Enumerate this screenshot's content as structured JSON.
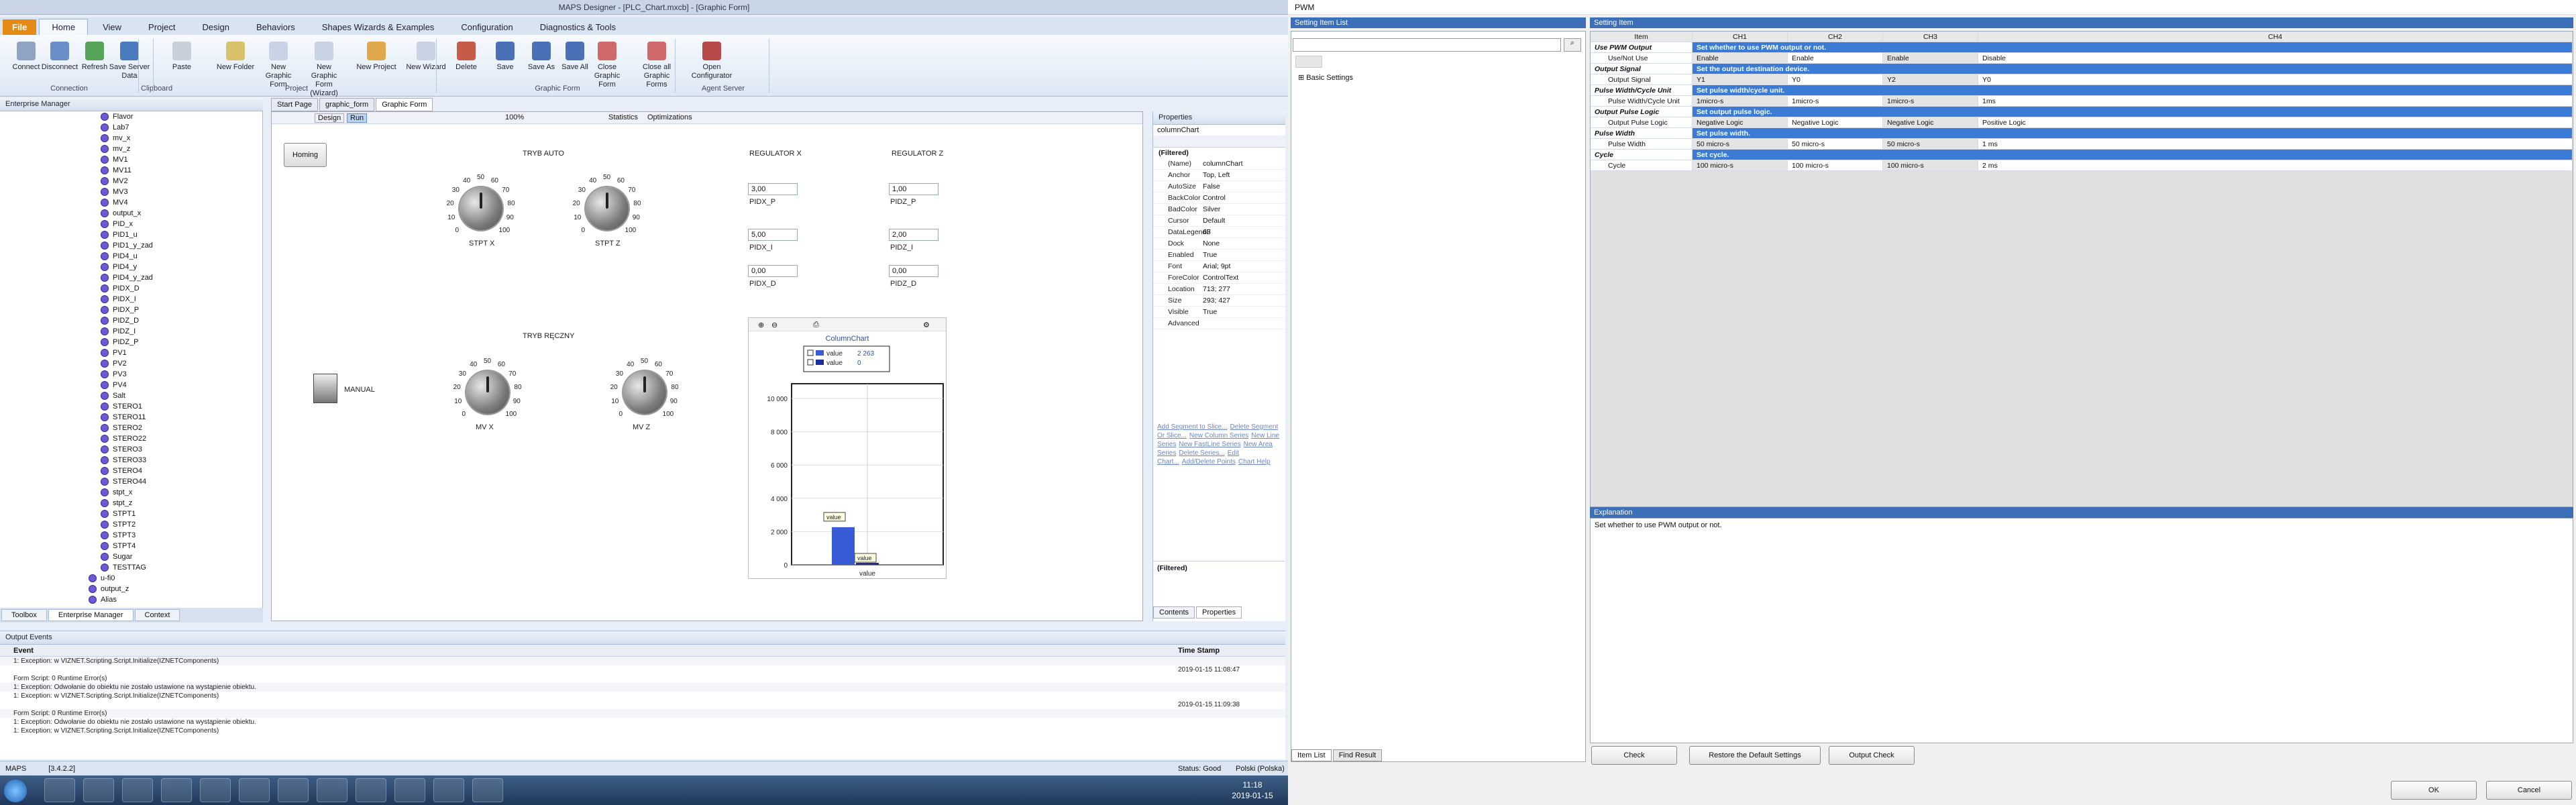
{
  "left_window": {
    "title": "MAPS Designer - [PLC_Chart.mxcb] - [Graphic Form]",
    "tabs": [
      "File",
      "Home",
      "View",
      "Project",
      "Design",
      "Behaviors",
      "Shapes Wizards & Examples",
      "Configuration",
      "Diagnostics & Tools"
    ],
    "ribbon": {
      "buttons": [
        "Connect",
        "Disconnect",
        "Refresh",
        "Save Server Data",
        "Paste",
        "New Folder",
        "New Graphic Form",
        "New Graphic Form (Wizard)",
        "New Project",
        "New Wizard",
        "Delete",
        "Save",
        "Save As",
        "Save All",
        "Close Graphic Form",
        "Close all Graphic Forms",
        "Open Configurator"
      ],
      "groups": [
        "Connection",
        "Clipboard",
        "Project",
        "Graphic Form",
        "Agent Server"
      ]
    },
    "enterprise_manager": {
      "title": "Enterprise Manager",
      "items": [
        "Flavor",
        "Lab7",
        "mv_x",
        "mv_z",
        "MV1",
        "MV11",
        "MV2",
        "MV3",
        "MV4",
        "output_x",
        "PID_x",
        "PID1_u",
        "PID1_y_zad",
        "PID4_u",
        "PID4_y",
        "PID4_y_zad",
        "PIDX_D",
        "PIDX_I",
        "PIDX_P",
        "PIDZ_D",
        "PIDZ_I",
        "PIDZ_P",
        "PV1",
        "PV2",
        "PV3",
        "PV4",
        "Salt",
        "STERO1",
        "STERO11",
        "STERO2",
        "STERO22",
        "STERO3",
        "STERO33",
        "STERO4",
        "STERO44",
        "stpt_x",
        "stpt_z",
        "STPT1",
        "STPT2",
        "STPT3",
        "STPT4",
        "Sugar",
        "TESTTAG",
        "u-fi0",
        "output_z",
        "Alias"
      ],
      "bottom_tabs": [
        "Toolbox",
        "Enterprise Manager",
        "Context"
      ]
    },
    "doc_tabs": [
      "Start Page",
      "graphic_form",
      "Graphic Form"
    ],
    "canvas_toolbar": {
      "design": "Design",
      "run": "Run",
      "zoom": "100%",
      "statistics": "Statistics",
      "optimizations": "Optimizations"
    },
    "form": {
      "homing": "Homing",
      "auto_title": "TRYB AUTO",
      "manual_title": "TRYB RĘCZNY",
      "manual": "MANUAL",
      "knob_ticks": [
        "0",
        "10",
        "20",
        "30",
        "40",
        "50",
        "60",
        "70",
        "80",
        "90",
        "100"
      ],
      "knobs": [
        "STPT X",
        "STPT Z",
        "MV X",
        "MV Z"
      ],
      "reg_x": "REGULATOR X",
      "reg_z": "REGULATOR Z",
      "pidx_p": "3,00",
      "pidx_p_l": "PIDX_P",
      "pidz_p": "1,00",
      "pidz_p_l": "PIDZ_P",
      "pidx_i": "5,00",
      "pidx_i_l": "PIDX_I",
      "pidz_i": "2,00",
      "pidz_i_l": "PIDZ_I",
      "pidx_d": "0,00",
      "pidx_d_l": "PIDX_D",
      "pidz_d": "0,00",
      "pidz_d_l": "PIDZ_D"
    },
    "chart_data": {
      "type": "bar",
      "title": "ColumnChart",
      "categories": [
        "value"
      ],
      "series": [
        {
          "name": "value",
          "values": [
            2263
          ]
        },
        {
          "name": "value",
          "values": [
            0
          ]
        }
      ],
      "legend_values": [
        "2 263",
        "0"
      ],
      "ylim": [
        0,
        10000
      ],
      "yticks": [
        "0",
        "2 000",
        "4 000",
        "6 000",
        "8 000",
        "10 000"
      ],
      "bar_labels": [
        "value",
        "value"
      ],
      "colors": [
        "#3a5bd6",
        "#1f2f9a"
      ]
    },
    "properties": {
      "title": "Properties",
      "object": "columnChart",
      "filter": "(Filtered)",
      "rows": [
        [
          "(Name)",
          "columnChart"
        ],
        [
          "Anchor",
          "Top, Left"
        ],
        [
          "AutoSize",
          "False"
        ],
        [
          "BackColor",
          "Control"
        ],
        [
          "BadColor",
          "Silver"
        ],
        [
          "Cursor",
          "Default"
        ],
        [
          "DataLegendF",
          "63"
        ],
        [
          "Dock",
          "None"
        ],
        [
          "Enabled",
          "True"
        ],
        [
          "Font",
          "Arial; 9pt"
        ],
        [
          "ForeColor",
          "ControlText"
        ],
        [
          "Location",
          "713; 277"
        ],
        [
          "Size",
          "293; 427"
        ],
        [
          "Visible",
          "True"
        ],
        [
          "Advanced",
          ""
        ]
      ],
      "links": [
        "Add Segment to Slice...",
        "Delete Segment Or Slice...",
        "New Column Series",
        "New Line Series",
        "New FastLine Series",
        "New Area Series",
        "Delete Series...",
        "Edit Chart...",
        "Add/Delete Points",
        "Chart Help"
      ],
      "footer": "(Filtered)",
      "tabs": [
        "Contents",
        "Properties"
      ]
    },
    "output": {
      "title": "Output Events",
      "headers": [
        "Event",
        "Time Stamp"
      ],
      "rows": [
        [
          "1: Exception:    w VIZNET.Scripting.Script.Initialize(IZNETComponents)",
          ""
        ],
        [
          "",
          "2019-01-15 11:08:47"
        ],
        [
          "Form Script: 0 Runtime Error(s)",
          ""
        ],
        [
          "1: Exception:  Odwołanie do obiektu nie zostało ustawione na wystąpienie obiektu.",
          ""
        ],
        [
          "1: Exception:    w VIZNET.Scripting.Script.Initialize(IZNETComponents)",
          ""
        ],
        [
          "",
          "2019-01-15 11:09:38"
        ],
        [
          "Form Script: 0 Runtime Error(s)",
          ""
        ],
        [
          "1: Exception:  Odwołanie do obiektu nie zostało ustawione na wystąpienie obiektu.",
          ""
        ],
        [
          "1: Exception:    w VIZNET.Scripting.Script.Initialize(IZNETComponents)",
          ""
        ]
      ]
    },
    "status": {
      "app": "MAPS",
      "version": "[3.4.2.2]",
      "status": "Status: Good",
      "lang": "Polski (Polska)"
    },
    "clock": {
      "time": "11:18",
      "date": "2019-01-15"
    }
  },
  "right_window": {
    "title": "PWM",
    "setting_item_list": "Setting Item List",
    "setting_item": "Setting Item",
    "tree_root": "Basic Settings",
    "columns": [
      "Item",
      "CH1",
      "CH2",
      "CH3",
      "CH4"
    ],
    "rows": [
      {
        "type": "cat",
        "item": "Use PWM Output",
        "desc": "Set whether to use PWM output or not."
      },
      {
        "type": "item",
        "item": "Use/Not Use",
        "vals": [
          "Enable",
          "Enable",
          "Enable",
          "Disable"
        ]
      },
      {
        "type": "cat",
        "item": "Output Signal",
        "desc": "Set the output destination device."
      },
      {
        "type": "item",
        "item": "Output Signal",
        "vals": [
          "Y1",
          "Y0",
          "Y2",
          "Y0"
        ]
      },
      {
        "type": "cat",
        "item": "Pulse Width/Cycle Unit",
        "desc": "Set pulse width/cycle unit."
      },
      {
        "type": "item",
        "item": "Pulse Width/Cycle Unit",
        "vals": [
          "1micro-s",
          "1micro-s",
          "1micro-s",
          "1ms"
        ]
      },
      {
        "type": "cat",
        "item": "Output Pulse Logic",
        "desc": "Set output pulse logic."
      },
      {
        "type": "item",
        "item": "Output Pulse Logic",
        "vals": [
          "Negative Logic",
          "Negative Logic",
          "Negative Logic",
          "Positive Logic"
        ]
      },
      {
        "type": "cat",
        "item": "Pulse Width",
        "desc": "Set pulse width."
      },
      {
        "type": "item",
        "item": "Pulse Width",
        "vals": [
          "50 micro-s",
          "50 micro-s",
          "50 micro-s",
          "1 ms"
        ]
      },
      {
        "type": "cat",
        "item": "Cycle",
        "desc": "Set cycle."
      },
      {
        "type": "item",
        "item": "Cycle",
        "vals": [
          "100 micro-s",
          "100 micro-s",
          "100 micro-s",
          "2 ms"
        ]
      }
    ],
    "explanation": "Explanation",
    "explanation_text": "Set whether to use PWM output or not.",
    "list_tabs": [
      "Item List",
      "Find Result"
    ],
    "buttons": {
      "check": "Check",
      "restore": "Restore the Default Settings",
      "output_check": "Output Check",
      "ok": "OK",
      "cancel": "Cancel"
    }
  }
}
